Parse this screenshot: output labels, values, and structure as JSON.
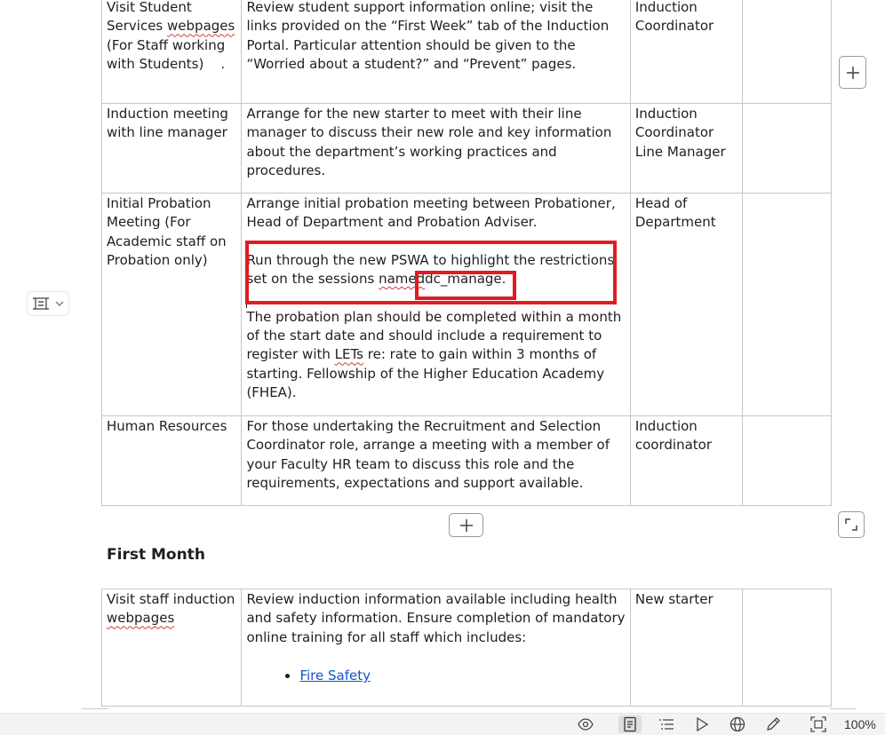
{
  "table1": {
    "rows": [
      {
        "activity_line1": "Visit Student",
        "activity_line2_prefix": "Services ",
        "activity_line2_spell": "webpages",
        "activity_rest": "(For Staff working with Students)    .",
        "description": "Review student support information online; visit the links provided on the “First Week” tab of the Induction Portal. Particular attention should be given to the “Worried about a student?” and “Prevent” pages.",
        "responsible": "Induction Coordinator",
        "notes": ""
      },
      {
        "activity": "Induction meeting with line manager",
        "description": "Arrange for the new starter to meet with their line manager to discuss their new role and key information about the department’s working practices and procedures.",
        "responsible_line1": "Induction Coordinator",
        "responsible_line2": "Line Manager",
        "notes": ""
      },
      {
        "activity": "Initial Probation Meeting (For Academic staff on Probation only)",
        "description_p1": "Arrange initial probation meeting between Probationer, Head of Department and Probation Adviser.",
        "description_p2_before": "Run through the new PSWA to highlight the restrictions set on the sessions ",
        "description_p2_spell": "named",
        "description_p2_highlight": "dc_manage.",
        "description_p3_before": "The probation plan should be completed within a month of the start date and should include a requirement to register with ",
        "description_p3_spell": "LETs",
        "description_p3_after": " re: rate to gain within 3 months of starting. Fellowship of the Higher Education Academy (FHEA).",
        "responsible": "Head of Department",
        "notes": ""
      },
      {
        "activity": "Human Resources",
        "description": "For those undertaking the Recruitment and Selection Coordinator role, arrange a meeting with a member of your Faculty HR team to discuss this role and the requirements, expectations and support available.",
        "responsible": "Induction coordinator",
        "notes": ""
      }
    ]
  },
  "section_heading": "First Month",
  "table2": {
    "rows": [
      {
        "activity_prefix": "Visit staff induction ",
        "activity_spell": "webpages",
        "description": "Review induction information available including health and safety information. Ensure completion of mandatory online training for all staff which includes:",
        "bullets": [
          "Fire Safety"
        ],
        "responsible": "New starter",
        "notes": ""
      }
    ]
  },
  "controls": {
    "add_column_icon": "plus-icon",
    "add_row_icon": "plus-icon",
    "table_resize_icon": "corner-resize-icon",
    "block_handle_icon": "block-frame-icon"
  },
  "status_bar": {
    "icons": [
      "eye-icon",
      "page-view-icon",
      "outline-icon",
      "play-icon",
      "globe-icon",
      "pen-icon",
      "fit-screen-icon"
    ],
    "zoom": "100%"
  },
  "colors": {
    "highlight_box": "#e11b22",
    "link": "#1155cc",
    "spellcheck": "#d43b3b"
  }
}
